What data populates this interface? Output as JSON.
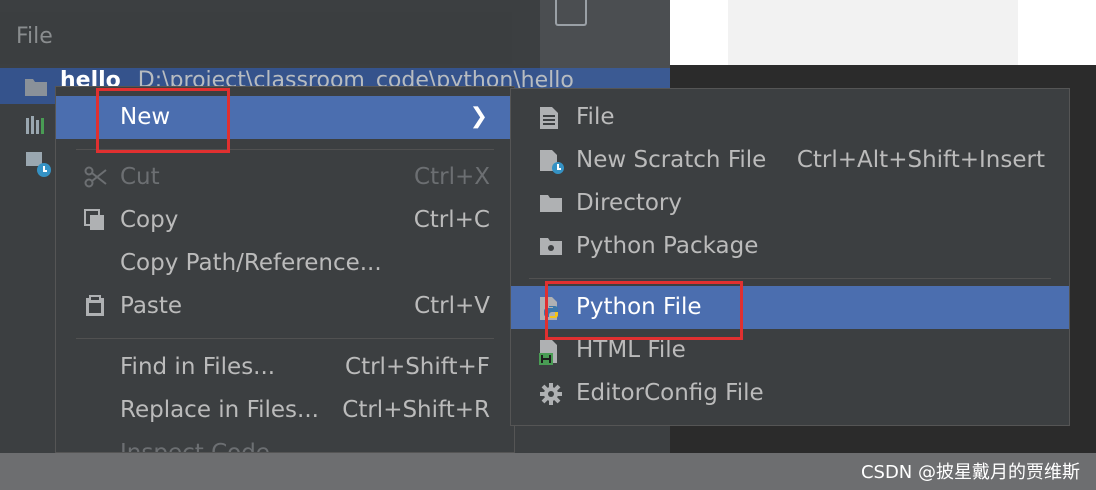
{
  "window": {
    "title": "File"
  },
  "project_tree": {
    "root_name": "hello",
    "root_path": "D:\\project\\classroom_code\\python\\hello"
  },
  "context_menu": {
    "items": [
      {
        "label": "New",
        "shortcut": "",
        "submenu": true,
        "selected": true
      },
      {
        "label": "Cut",
        "shortcut": "Ctrl+X",
        "disabled": true
      },
      {
        "label": "Copy",
        "shortcut": "Ctrl+C"
      },
      {
        "label": "Copy Path/Reference...",
        "shortcut": ""
      },
      {
        "label": "Paste",
        "shortcut": "Ctrl+V"
      },
      {
        "label": "Find in Files...",
        "shortcut": "Ctrl+Shift+F"
      },
      {
        "label": "Replace in Files...",
        "shortcut": "Ctrl+Shift+R"
      },
      {
        "label": "Inspect Code...",
        "shortcut": "",
        "disabled": true
      }
    ]
  },
  "new_submenu": {
    "items": [
      {
        "label": "File",
        "icon": "file-icon"
      },
      {
        "label": "New Scratch File",
        "shortcut": "Ctrl+Alt+Shift+Insert",
        "icon": "scratch-file-icon"
      },
      {
        "label": "Directory",
        "icon": "folder-icon"
      },
      {
        "label": "Python Package",
        "icon": "package-icon"
      },
      {
        "label": "Python File",
        "icon": "python-file-icon",
        "selected": true
      },
      {
        "label": "HTML File",
        "icon": "html-file-icon"
      },
      {
        "label": "EditorConfig File",
        "icon": "gear-icon"
      }
    ]
  },
  "colors": {
    "menu_bg": "#3c3f41",
    "selection": "#4b6eaf",
    "highlight_box": "#e03030"
  },
  "watermark": "CSDN @披星戴月的贾维斯"
}
